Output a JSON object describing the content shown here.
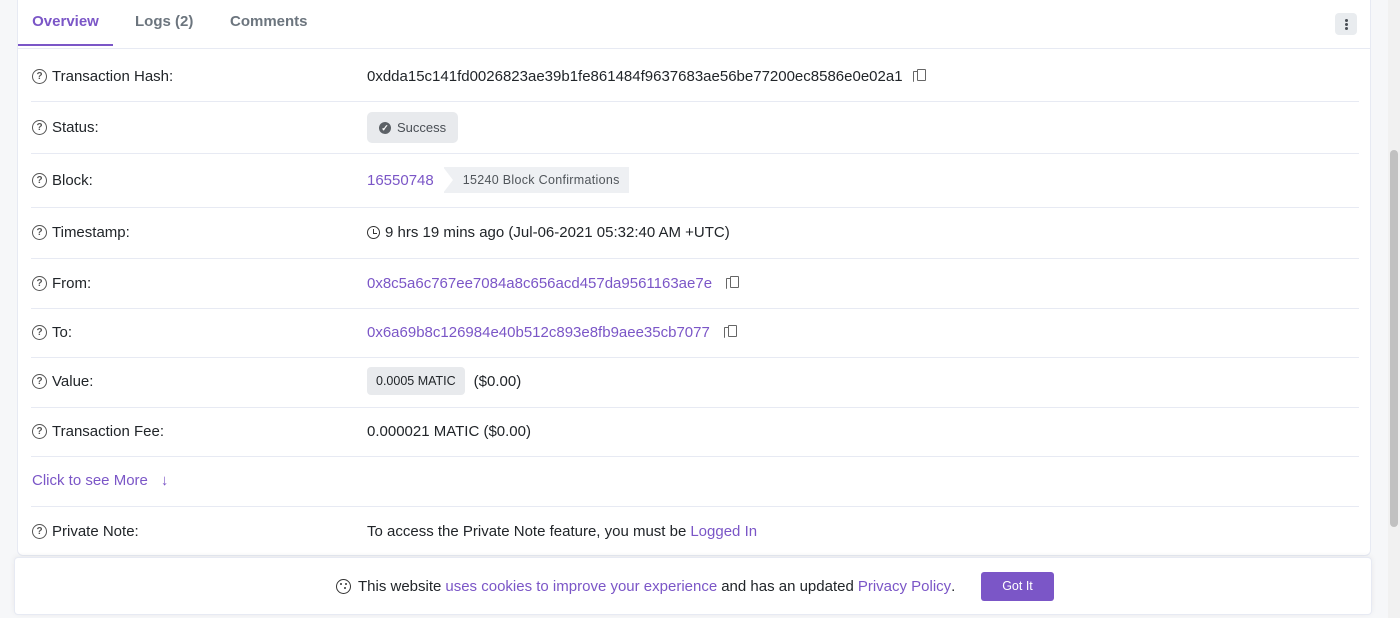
{
  "tabs": [
    {
      "label": "Overview",
      "active": true
    },
    {
      "label": "Logs (2)",
      "active": false
    },
    {
      "label": "Comments",
      "active": false
    }
  ],
  "rows": {
    "tx_hash": {
      "label": "Transaction Hash:",
      "value": "0xdda15c141fd0026823ae39b1fe861484f9637683ae56be77200ec8586e0e02a1"
    },
    "status": {
      "label": "Status:",
      "value": "Success"
    },
    "block": {
      "label": "Block:",
      "value": "16550748",
      "confirmations": "15240 Block Confirmations"
    },
    "timestamp": {
      "label": "Timestamp:",
      "value": "9 hrs 19 mins ago (Jul-06-2021 05:32:40 AM +UTC)"
    },
    "from": {
      "label": "From:",
      "value": "0x8c5a6c767ee7084a8c656acd457da9561163ae7e"
    },
    "to": {
      "label": "To:",
      "value": "0x6a69b8c126984e40b512c893e8fb9aee35cb7077"
    },
    "value": {
      "label": "Value:",
      "amount": "0.0005 MATIC",
      "usd": "($0.00)"
    },
    "fee": {
      "label": "Transaction Fee:",
      "value": "0.000021 MATIC ($0.00)"
    },
    "see_more": {
      "label": "Click to see More",
      "icon": "arrow-down-icon"
    },
    "private_note": {
      "label": "Private Note:",
      "text": "To access the Private Note feature, you must be",
      "link": "Logged In"
    }
  },
  "cookie": {
    "text1": "This website",
    "link1": "uses cookies to improve your experience",
    "text2": "and has an updated",
    "link2": "Privacy Policy",
    "text3": ".",
    "button": "Got It"
  },
  "colors": {
    "accent": "#7b56c7",
    "border": "#e7eaf3"
  }
}
